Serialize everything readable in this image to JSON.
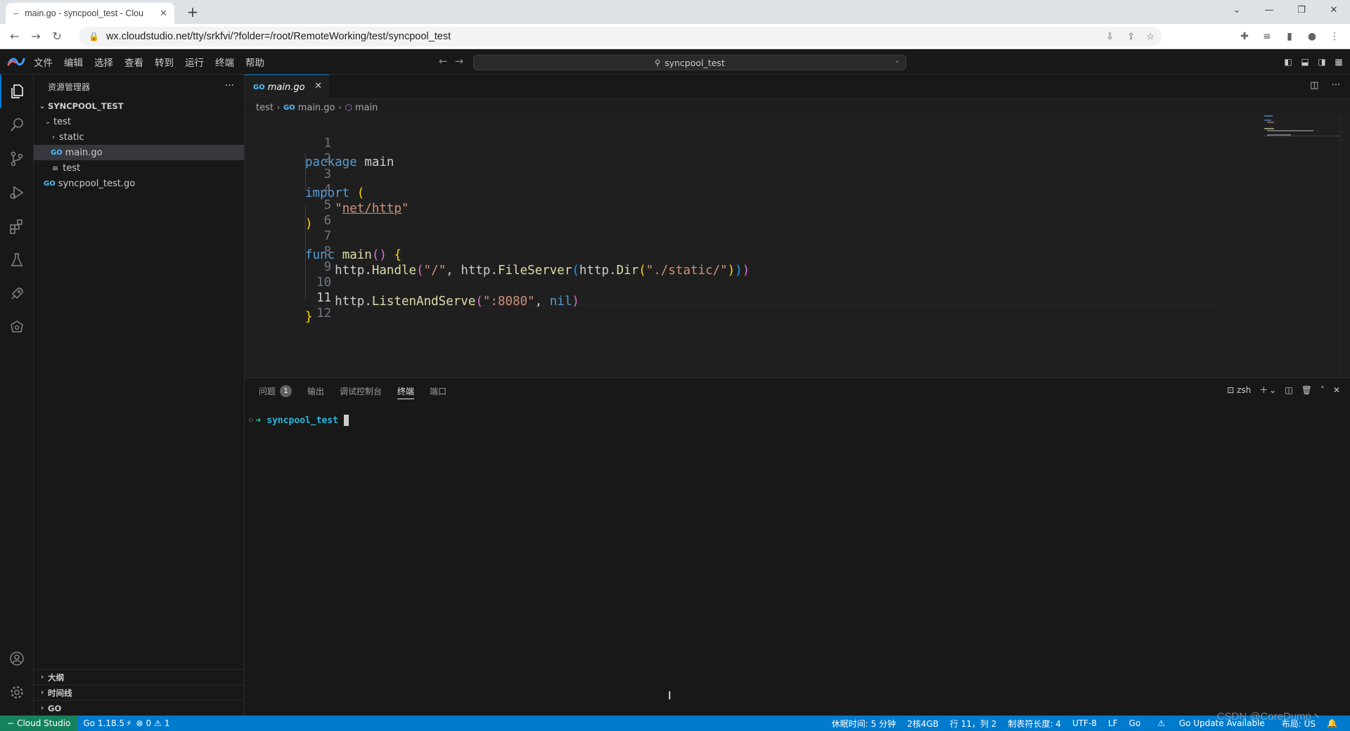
{
  "browser": {
    "tab_title": "main.go - syncpool_test - Clou",
    "url": "wx.cloudstudio.net/tty/srkfvi/?folder=/root/RemoteWorking/test/syncpool_test",
    "window_controls": [
      "⌄",
      "—",
      "❐",
      "✕"
    ]
  },
  "menu": {
    "items": [
      "文件",
      "编辑",
      "选择",
      "查看",
      "转到",
      "运行",
      "终端",
      "帮助"
    ],
    "command_center": "syncpool_test"
  },
  "explorer": {
    "title": "资源管理器",
    "root": "SYNCPOOL_TEST",
    "items": [
      {
        "label": "test",
        "type": "folder-open"
      },
      {
        "label": "static",
        "type": "folder"
      },
      {
        "label": "main.go",
        "type": "go"
      },
      {
        "label": "test",
        "type": "file"
      },
      {
        "label": "syncpool_test.go",
        "type": "go"
      }
    ],
    "bottom_sections": [
      "大纲",
      "时间线",
      "GO"
    ]
  },
  "editor": {
    "tab_label": "main.go",
    "breadcrumb": [
      "test",
      "main.go",
      "main"
    ],
    "line_numbers": [
      "1",
      "2",
      "3",
      "4",
      "5",
      "6",
      "7",
      "8",
      "9",
      "10",
      "11",
      "12"
    ],
    "current_line": "11"
  },
  "panel": {
    "tabs": [
      "问题",
      "输出",
      "调试控制台",
      "终端",
      "端口"
    ],
    "problems_count": "1",
    "shell": "zsh",
    "terminal_prompt": "syncpool_test"
  },
  "statusbar": {
    "remote": "Cloud Studio",
    "go_version": "Go 1.18.5",
    "errors": "0",
    "warnings": "1",
    "right_items": [
      "休眠时间: 5 分钟",
      "2核4GB",
      "行 11，列 2",
      "制表符长度: 4",
      "UTF-8",
      "LF",
      "Go",
      "Go Update Available",
      "布局: US"
    ]
  },
  "watermark": "CSDN @CoreDump丶"
}
